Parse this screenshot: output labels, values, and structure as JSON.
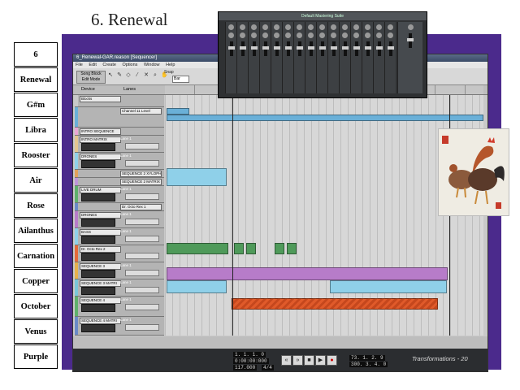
{
  "slide_title": "6. Renewal",
  "labels": [
    "6",
    "Renewal",
    "G#m",
    "Libra",
    "Rooster",
    "Air",
    "Rose",
    "Ailanthus",
    "Carnation",
    "Copper",
    "October",
    "Venus",
    "Purple"
  ],
  "window": {
    "title": "6_Renewal-GAR.reason [Sequencer]",
    "menu": [
      "File",
      "Edit",
      "Create",
      "Options",
      "Window",
      "Help"
    ],
    "song_label": "Song",
    "block_label": "Block",
    "edit_mode_label": "Edit Mode",
    "snap_label": "Snap",
    "snap_value": "Bar",
    "device_header": "Device",
    "lanes_header": "Lanes"
  },
  "tracks": [
    {
      "name": "Blocks",
      "color": "#c9c9c9"
    },
    {
      "name": "Channel 11 Level",
      "color": "#6ab0d8"
    },
    {
      "name": "INTRO SEQUENCE",
      "color": "#e9a6d4"
    },
    {
      "name": "INTRO MATRIX",
      "color": "#e3c48f"
    },
    {
      "name": "DRONES",
      "color": "#8fd0e9"
    },
    {
      "name": "SEQUENCE 2 XYLOPH",
      "color": "#e1a25b"
    },
    {
      "name": "SEQUENCE 2 MATRIX",
      "color": "#bf95d9"
    },
    {
      "name": "LIVE DRUM",
      "color": "#5fb06c"
    },
    {
      "name": "Dr. Octo Rex 1",
      "color": "#6a8ac7"
    },
    {
      "name": "DRONES",
      "color": "#b77cc9"
    },
    {
      "name": "BASS",
      "color": "#8fd0e9"
    },
    {
      "name": "Dr. Octo Rex 2",
      "color": "#e56a3b"
    },
    {
      "name": "SEQUENCE 3",
      "color": "#e7b04c"
    },
    {
      "name": "SEQUENCE 3 MATRI",
      "color": "#7ac6d8"
    },
    {
      "name": "SEQUENCE 4",
      "color": "#5fb06c"
    },
    {
      "name": "SEQUENCE 4 MATRI",
      "color": "#6a8ac7"
    }
  ],
  "lane_label": "Lane 1",
  "mixer_title": "Default Mastering Suite",
  "transport": {
    "position": "1. 1. 1. 0",
    "time": "0:00:00:000",
    "tempo": "117.000",
    "signature": "4/4",
    "left_locator": "73. 1. 2. 9",
    "right_locator": "300. 3. 4. 0"
  },
  "footer": "Transformations - 20"
}
